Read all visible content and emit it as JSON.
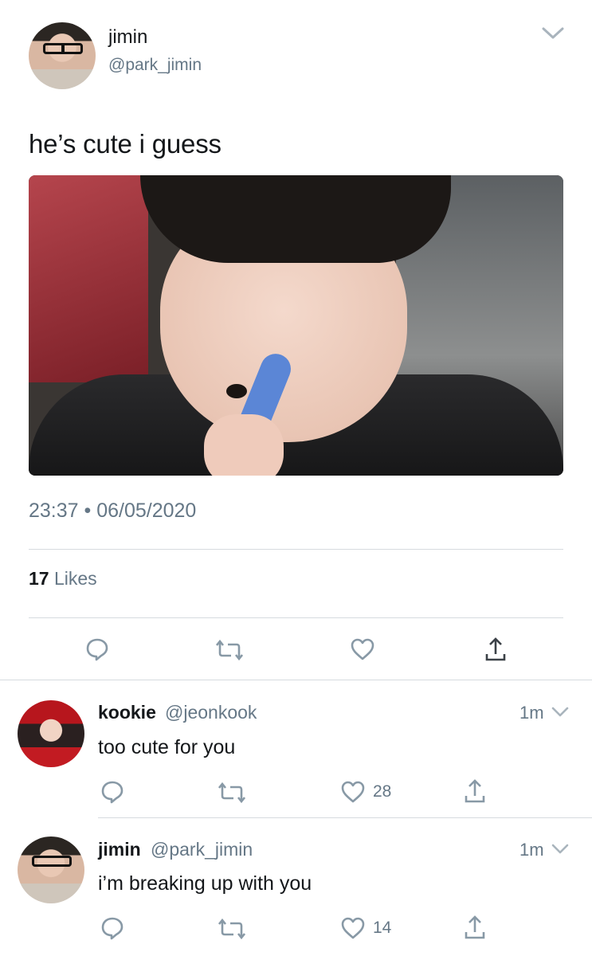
{
  "main_tweet": {
    "name": "jimin",
    "handle": "@park_jimin",
    "text": "he’s cute i guess",
    "timestamp": "23:37 • 06/05/2020",
    "likes_count": "17",
    "likes_label": "Likes"
  },
  "replies": [
    {
      "name": "kookie",
      "handle": "@jeonkook",
      "time": "1m",
      "text": "too cute for you",
      "like_count": "28"
    },
    {
      "name": "jimin",
      "handle": "@park_jimin",
      "time": "1m",
      "text": "i’m breaking up with you",
      "like_count": "14"
    }
  ],
  "icons": [
    "chevron-down-icon",
    "reply-icon",
    "retweet-icon",
    "heart-icon",
    "share-icon"
  ],
  "colors": {
    "text": "#14171a",
    "secondary": "#657786",
    "divider": "#d6dbdf"
  }
}
